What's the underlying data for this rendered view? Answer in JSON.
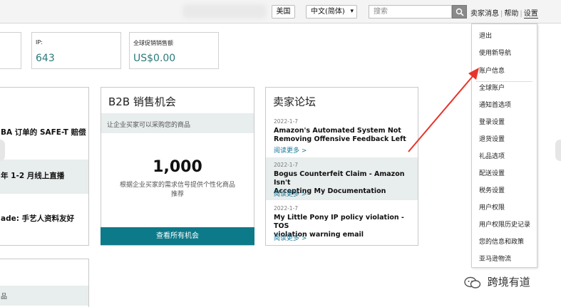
{
  "topbar": {
    "flag_button": "美国",
    "language": "中文(简体)",
    "search_placeholder": "搜索",
    "links": [
      "卖家消息",
      "帮助",
      "设置"
    ]
  },
  "metrics": [
    {
      "label": "IP:",
      "value": "643"
    },
    {
      "label": "全球促销销售额",
      "value": "US$0.00"
    }
  ],
  "left_card": {
    "line1": "BA 订单的 SAFE-T 赔偿",
    "line2": "年 1-2 月线上直播",
    "line3": "ade:  手艺人资料友好",
    "bottom_text": "品"
  },
  "b2b": {
    "title": "B2B 销售机会",
    "desc": "让企业买家可以采购您的商品",
    "count": "1,000",
    "note_line1": "根据企业买家的需求信号提供个性化商品",
    "note_line2": "推荐",
    "button": "查看所有机会"
  },
  "forum": {
    "title": "卖家论坛",
    "read_more": "阅读更多 >",
    "posts": [
      {
        "date": "2022-1-7",
        "title_line1": "Amazon's Automated System Not",
        "title_line2": "Removing Offensive Feedback Left"
      },
      {
        "date": "2022-1-7",
        "title_line1": "Bogus Counterfeit Claim - Amazon Isn't",
        "title_line2": "Accepting My Documentation"
      },
      {
        "date": "2022-1-7",
        "title_line1": "My Little Pony IP policy violation - TOS",
        "title_line2": "violation warning email"
      }
    ]
  },
  "settings_menu": {
    "items": [
      "退出",
      "使用新导航",
      "账户信息",
      "全球账户",
      "通知首选项",
      "登录设置",
      "退货设置",
      "礼品选项",
      "配送设置",
      "税务设置",
      "用户权限",
      "用户权限历史记录",
      "您的信息和政策",
      "亚马逊物流"
    ]
  },
  "annotation": {
    "arrow_color": "#e8332b"
  },
  "watermark": {
    "text": "跨境有道",
    "icon": "wechat-icon"
  }
}
